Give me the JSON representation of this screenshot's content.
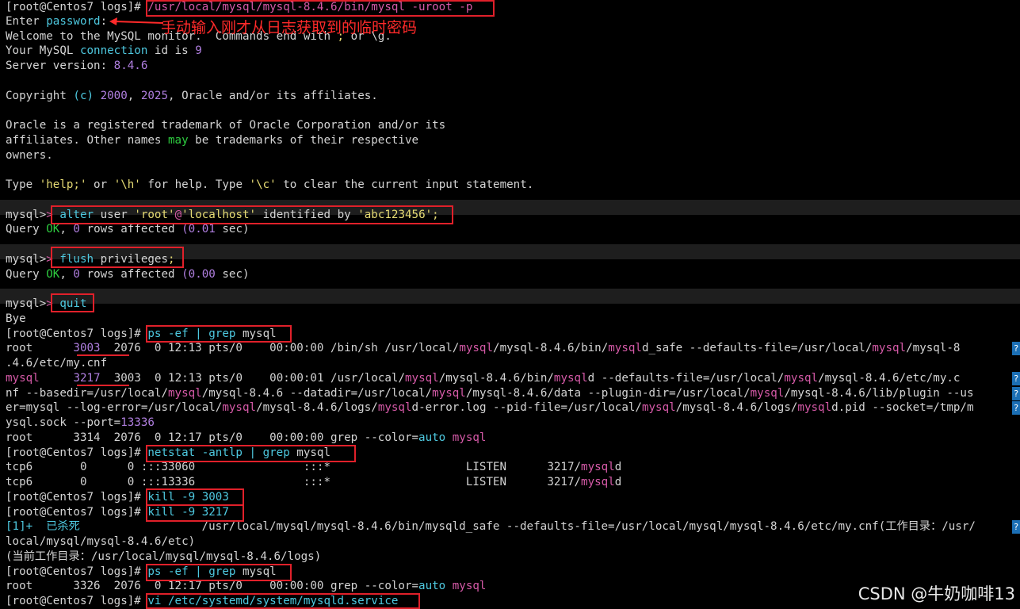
{
  "prompt": "[root@Centos7 logs]#",
  "mysql_prompt": "mysql>",
  "annotation": "手动输入刚才从日志获取到的临时密码",
  "watermark": "CSDN @牛奶咖啡13",
  "login_cmd": "/usr/local/mysql/mysql-8.4.6/bin/mysql -uroot -p",
  "enter": "Enter",
  "password_word": "password",
  "welcome_a": "Welcome to the MySQL monitor.  Commands end with ",
  "welcome_semi": ";",
  "welcome_or": " or ",
  "welcome_g": "\\g.",
  "your_mysql": "Your MySQL ",
  "connection_word": "connection",
  "id_is": " id is ",
  "conn_id": "9",
  "server_version_label": "Server version: ",
  "server_version": "8.4.6",
  "copy_a": "Copyright ",
  "copy_c": "(c)",
  "copy_y1": " 2000",
  "copy_comma": ",",
  "copy_y2": " 2025",
  "copy_b": ", Oracle and/or its affiliates.",
  "oracle1": "Oracle is a registered trademark of Oracle Corporation and/or its",
  "oracle2a": "affiliates. Other names ",
  "oracle2_may": "may",
  "oracle2b": " be trademarks of their respective",
  "oracle3": "owners.",
  "type_a": "Type ",
  "type_help": "'help;'",
  "type_or": " or ",
  "type_h": "'\\h'",
  "type_b": " for help. Type ",
  "type_c": "'\\c'",
  "type_d": " to clear the current input statement.",
  "alter_kw": "alter",
  "alter_user": " user ",
  "alter_root": "'root'",
  "alter_at": "@",
  "alter_host": "'localhost'",
  "alter_ident": " identified by ",
  "alter_pw": "'abc123456'",
  "semicolon": ";",
  "query_a": "Query ",
  "ok": "OK",
  "comma": ",",
  "zero": " 0",
  "rows_affected": " rows affected ",
  "sec_a": "(0.01",
  "sec_b": "(0.00",
  "sec_end": " sec)",
  "flush_kw": "flush",
  "flush_rest": " privileges",
  "quit": "quit",
  "bye": "Bye",
  "ps_cmd_a": "ps -ef | grep",
  "ps_cmd_b": " mysql",
  "ps1_a": "root      ",
  "ps1_pid": "3003",
  "ps1_b": "  2076  0 12:13 pts/0    00:00:00 /bin/sh /usr/local/",
  "mysql_word": "mysql",
  "ps1_c": "/mysql-8.4.6/bin/",
  "ps1_d": "d_safe --defaults-file=/usr/local/",
  "ps1_e": "/mysql-8",
  "ps1_wrap": ".4.6/etc/my.cnf",
  "ps2_user": "mysql",
  "ps2_a": "     ",
  "ps2_pid": "3217",
  "ps2_b": "  3003  0 12:13 pts/0    00:00:01 /usr/local/",
  "ps2_c": "/mysql-8.4.6/bin/",
  "ps2_d": "d --defaults-file=/usr/local/",
  "ps2_e": "/mysql-8.4.6/etc/my.c",
  "ps3_a": "nf --basedir=/usr/local/",
  "ps3_b": "/mysql-8.4.6 --datadir=/usr/local/",
  "ps3_c": "/mysql-8.4.6/data --plugin-dir=/usr/local/",
  "ps3_d": "/mysql-8.4.6/lib/plugin --us",
  "ps4_a": "er=mysql --log-error=/usr/local/",
  "ps4_b": "/mysql-8.4.6/logs/",
  "ps4_c": "d-error.log --pid-file=/usr/local/",
  "ps4_d": "/mysql-8.4.6/logs/",
  "ps4_e": "d.pid --socket=/tmp/m",
  "ps5_a": "ysql.sock --port=",
  "ps5_port": "13336",
  "ps6_a": "root      3314  2076  0 12:17 pts/0    00:00:00 grep --color=",
  "auto": "auto",
  "netstat_cmd_a": "netstat -antlp | grep",
  "netstat_cmd_b": " mysql",
  "net1_a": "tcp6       0      0 :::33060                :::*                    LISTEN      3217/",
  "net2_a": "tcp6       0      0 :::13336                :::*                    LISTEN      3217/",
  "mysqld_d": "d",
  "kill1_cmd": "kill -9 3003",
  "kill2_cmd": "kill -9 3217",
  "job_a": "[1]+  已杀死",
  "job_b": "                  /usr/local/mysql/mysql-8.4.6/bin/mysqld_safe --defaults-file=/usr/local/mysql/mysql-8.4.6/etc/my.cnf(工作目录：/usr/",
  "job_wrap": "local/mysql/mysql-8.4.6/etc)",
  "job_cwd": "(当前工作目录：/usr/local/mysql/mysql-8.4.6/logs)",
  "ps_last_a": "root      3326  2076  0 12:17 pts/0    00:00:00 grep --color=",
  "vi_cmd": "vi /etc/systemd/system/mysqld.service",
  "wrap_glyph": "?"
}
